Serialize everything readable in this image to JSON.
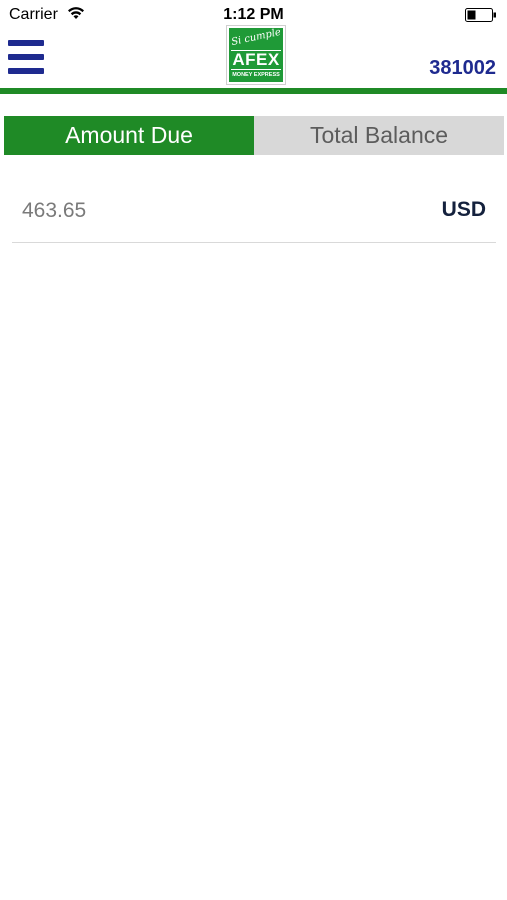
{
  "status_bar": {
    "carrier": "Carrier",
    "time": "1:12 PM",
    "wifi_icon": "wifi-icon",
    "battery_icon": "battery-icon"
  },
  "header": {
    "menu_icon": "hamburger-menu-icon",
    "logo": {
      "slogan": "Si cumple",
      "brand": "AFEX",
      "subtitle": "MONEY EXPRESS"
    },
    "account_number": "381002"
  },
  "tabs": [
    {
      "label": "Amount Due",
      "selected": true
    },
    {
      "label": "Total Balance",
      "selected": false
    }
  ],
  "balance_row": {
    "amount": "463.65",
    "currency": "USD"
  },
  "colors": {
    "brand_green": "#1f8a26",
    "logo_green": "#1f9a37",
    "navy": "#1e2a8f",
    "tab_inactive_bg": "#d8d8d8"
  }
}
